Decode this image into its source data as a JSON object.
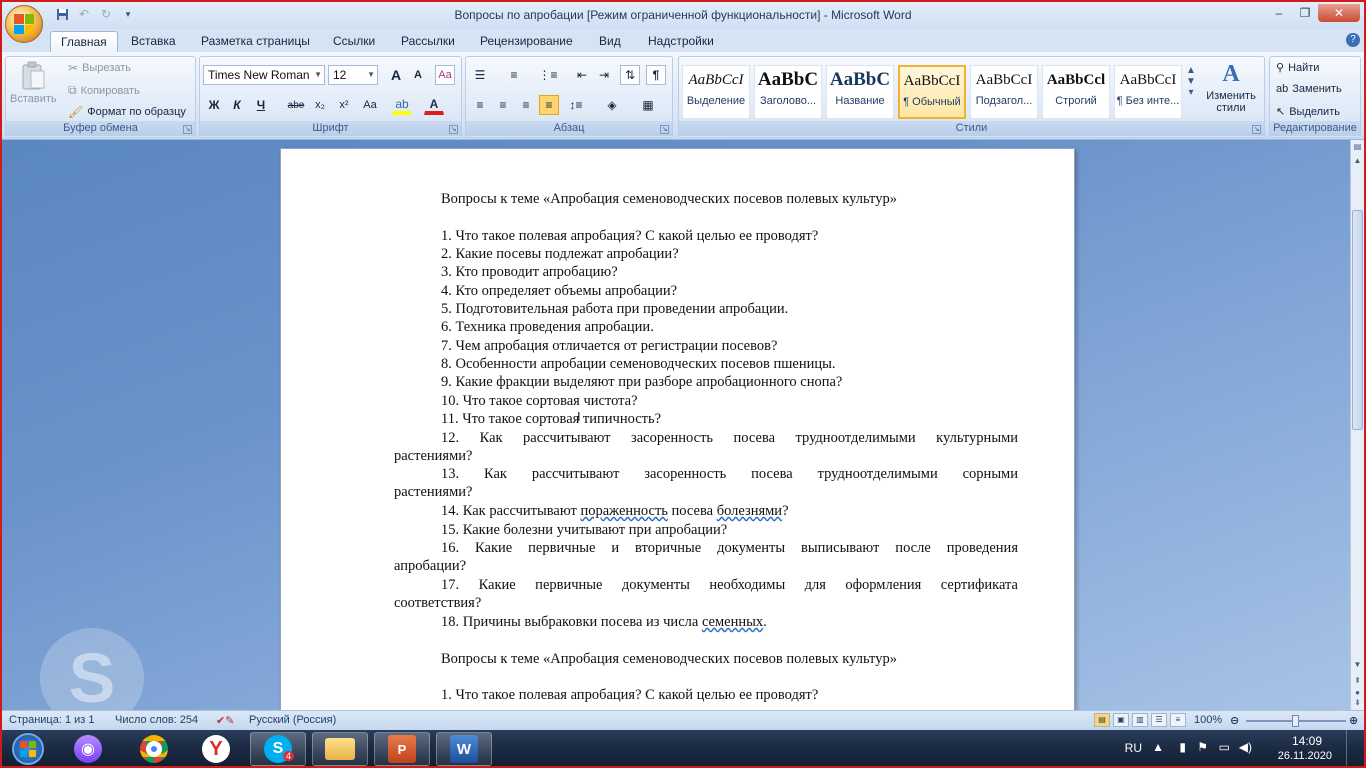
{
  "window": {
    "title": "Вопросы по апробации [Режим ограниченной функциональности] - Microsoft Word",
    "minimize": "‒",
    "restore": "❐",
    "close": "✕"
  },
  "tabs": [
    {
      "label": "Главная",
      "active": true
    },
    {
      "label": "Вставка"
    },
    {
      "label": "Разметка страницы"
    },
    {
      "label": "Ссылки"
    },
    {
      "label": "Рассылки"
    },
    {
      "label": "Рецензирование"
    },
    {
      "label": "Вид"
    },
    {
      "label": "Надстройки"
    }
  ],
  "ribbon": {
    "clipboard": {
      "group_label": "Буфер обмена",
      "paste": "Вставить",
      "cut": "Вырезать",
      "copy": "Копировать",
      "format_painter": "Формат по образцу"
    },
    "font": {
      "group_label": "Шрифт",
      "font_name": "Times New Roman",
      "font_size": "12",
      "bold": "Ж",
      "italic": "К",
      "underline": "Ч",
      "strike": "abe",
      "subscript": "x₂",
      "superscript": "x²",
      "change_case": "Aa",
      "grow": "A",
      "shrink": "A"
    },
    "paragraph": {
      "group_label": "Абзац"
    },
    "styles": {
      "group_label": "Стили",
      "items": [
        {
          "sample": "AaBbCcI",
          "name": "Выделение"
        },
        {
          "sample": "AaBbC",
          "name": "Заголово..."
        },
        {
          "sample": "AaBbC",
          "name": "Название"
        },
        {
          "sample": "AaBbCcI",
          "name": "¶ Обычный",
          "selected": true
        },
        {
          "sample": "AaBbCcI",
          "name": "Подзагол..."
        },
        {
          "sample": "AaBbCcl",
          "name": "Строгий"
        },
        {
          "sample": "AaBbCcI",
          "name": "¶ Без инте..."
        }
      ],
      "change_styles": "Изменить стили"
    },
    "editing": {
      "group_label": "Редактирование",
      "find": "Найти",
      "replace": "Заменить",
      "select": "Выделить"
    }
  },
  "document": {
    "heading": "Вопросы к теме «Апробация семеноводческих посевов полевых культур»",
    "questions": [
      "1. Что такое полевая апробация? С какой целью ее проводят?",
      "2. Какие посевы подлежат апробации?",
      "3. Кто проводит апробацию?",
      "4. Кто определяет объемы апробации?",
      "5. Подготовительная работа при проведении апробации.",
      "6. Техника проведения апробации.",
      "7. Чем апробация отличается от регистрации посевов?",
      "8. Особенности апробации семеноводческих посевов пшеницы.",
      "9. Какие фракции выделяют при разборе апробационного снопа?",
      "10. Что такое сортовая чистота?",
      "11. Что такое сортовая типичность?"
    ],
    "q12_line1": "12. Как рассчитывают засоренность посева трудноотделимыми культурными",
    "q12_line2": "растениями?",
    "q13_line1": "13. Как рассчитывают засоренность посева трудноотделимыми сорными",
    "q13_line2": "растениями?",
    "q14_pre": "14. Как рассчитывают ",
    "q14_word": "пораженность",
    "q14_mid": " посева ",
    "q14_word2": "болезнями",
    "q14_end": "?",
    "q15": "15. Какие болезни учитывают при апробации?",
    "q16_line1": "16. Какие первичные и вторичные документы выписывают после проведения",
    "q16_line2": "апробации?",
    "q17_line1": "17. Какие первичные документы необходимы для оформления сертификата",
    "q17_line2": "соответствия?",
    "q18_pre": "18. Причины выбраковки посева из числа ",
    "q18_word": "семенных",
    "q18_end": ".",
    "heading2": "Вопросы к теме «Апробация семеноводческих посевов полевых культур»",
    "repeat_q1": "1. Что такое полевая апробация? С какой целью ее проводят?"
  },
  "statusbar": {
    "page": "Страница: 1 из 1",
    "words": "Число слов: 254",
    "language": "Русский (Россия)",
    "zoom": "100%"
  },
  "taskbar": {
    "lang": "RU",
    "time": "14:09",
    "date": "26.11.2020",
    "skype_badge": "4"
  },
  "colors": {
    "accent": "#3a6fb5",
    "selected_style": "#f1b233",
    "frame": "#d21a1a"
  }
}
